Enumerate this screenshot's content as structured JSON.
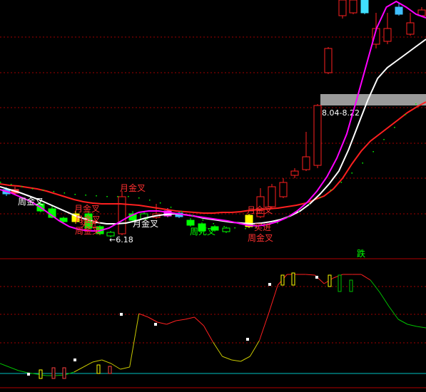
{
  "chart_data": {
    "type": "candlestick",
    "upper_panel": {
      "highlight_range_text": "8.04-8.22",
      "low_marker_text": "←6.18",
      "signals": [
        {
          "text": "周金叉",
          "color": "#ffffff"
        },
        {
          "text": "月金叉",
          "color": "#ff3030"
        },
        {
          "text": "月金叉",
          "color": "#ff3030"
        },
        {
          "text": "周金叉",
          "color": "#ff3030"
        },
        {
          "text": "买进",
          "color": "#ff3030"
        },
        {
          "text": "月金叉",
          "color": "#ffffff"
        },
        {
          "text": "周死叉",
          "color": "#00ff00"
        },
        {
          "text": "月金叉",
          "color": "#ff3030"
        },
        {
          "text": "买进",
          "color": "#ff3030"
        },
        {
          "text": "周金叉",
          "color": "#ff3030"
        }
      ],
      "lines": [
        {
          "color": "#ff2020",
          "values": [
            258,
            260,
            261,
            263,
            265,
            268,
            272,
            276,
            280,
            283,
            285,
            286,
            286,
            286,
            287,
            288,
            290,
            292,
            294,
            296,
            297,
            298,
            299,
            299,
            298,
            298,
            297,
            295,
            294,
            293,
            292,
            290,
            288,
            285,
            280,
            275,
            265,
            250,
            230,
            212,
            198,
            188,
            178,
            168,
            158,
            150,
            143
          ]
        },
        {
          "color": "#ffffff",
          "values": [
            262,
            266,
            270,
            275,
            280,
            286,
            292,
            298,
            304,
            308,
            312,
            314,
            314,
            313,
            310,
            306,
            303,
            301,
            300,
            301,
            303,
            306,
            308,
            310,
            312,
            313,
            314,
            313,
            311,
            308,
            303,
            296,
            286,
            273,
            258,
            240,
            210,
            175,
            140,
            110,
            95,
            85,
            75,
            65,
            55
          ]
        },
        {
          "color": "#ff00ff",
          "values": [
            266,
            270,
            276,
            282,
            290,
            300,
            310,
            318,
            322,
            324,
            324,
            320,
            312,
            304,
            298,
            296,
            296,
            298,
            300,
            302,
            304,
            306,
            308,
            310,
            313,
            316,
            317,
            315,
            311,
            305,
            296,
            284,
            268,
            248,
            222,
            188,
            140,
            90,
            40,
            10,
            2,
            10,
            20,
            25
          ]
        }
      ],
      "dotted_line": {
        "color": "#00ff00",
        "values": [
          255,
          258,
          261,
          264,
          266,
          268,
          270,
          272,
          273,
          274,
          275,
          275,
          275,
          277,
          280,
          284,
          290,
          296,
          302,
          308,
          313,
          317,
          319,
          320,
          318,
          316,
          312,
          304,
          296,
          286,
          276,
          266,
          255,
          242,
          228,
          212,
          195,
          178,
          160,
          145,
          130
        ]
      }
    },
    "lower_panel": {
      "top_label": "跌",
      "line_values": [
        510,
        515,
        520,
        523,
        525,
        527,
        527,
        526,
        522,
        515,
        508,
        505,
        510,
        518,
        515,
        440,
        445,
        452,
        455,
        450,
        448,
        445,
        457,
        480,
        500,
        505,
        507,
        500,
        478,
        440,
        400,
        385,
        385,
        385,
        386,
        398,
        390,
        385,
        385,
        385,
        393,
        410,
        430,
        448,
        455,
        458,
        460
      ]
    }
  }
}
